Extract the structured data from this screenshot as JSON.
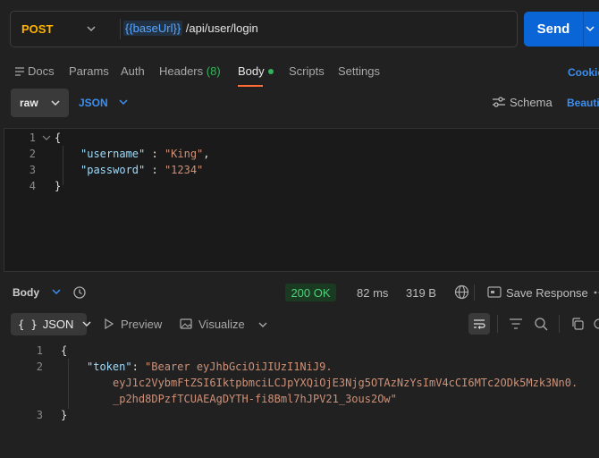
{
  "request": {
    "method": "POST",
    "url_variable": "{{baseUrl}}",
    "url_path": " /api/user/login",
    "send_label": "Send"
  },
  "tabs": {
    "docs": "Docs",
    "params": "Params",
    "auth": "Auth",
    "headers": "Headers",
    "headers_count": "(8)",
    "body": "Body",
    "scripts": "Scripts",
    "settings": "Settings",
    "cookies": "Cookies"
  },
  "body_toolbar": {
    "mode": "raw",
    "language": "JSON",
    "schema": "Schema",
    "beautify": "Beautify"
  },
  "editor": {
    "lines": [
      {
        "no": "1",
        "text": "{"
      },
      {
        "no": "2",
        "key": "\"username\"",
        "sep": " : ",
        "value": "\"King\"",
        "tail": ","
      },
      {
        "no": "3",
        "key": "\"password\"",
        "sep": " : ",
        "value": "\"1234\"",
        "tail": ""
      },
      {
        "no": "4",
        "text": "}"
      }
    ]
  },
  "response": {
    "section_label": "Body",
    "status": "200 OK",
    "time": "82 ms",
    "size": "319 B",
    "save_label": "Save Response",
    "format": "JSON",
    "preview": "Preview",
    "visualize": "Visualize",
    "lines": [
      {
        "no": "1",
        "text": "{"
      },
      {
        "no": "2",
        "key": "\"token\"",
        "sep": ": ",
        "value1": "\"Bearer eyJhbGciOiJIUzI1NiJ9.",
        "value2": "eyJ1c2VybmFtZSI6IktpbmciLCJpYXQiOjE3Njg5OTAzNzYsImV4cCI6MTc2ODk5Mzk3Nn0.",
        "value3": "_p2hd8DPzfTCUAEAgDYTH-fi8Bml7hJPV21_3ous2Ow\""
      },
      {
        "no": "3",
        "text": "}"
      }
    ]
  }
}
